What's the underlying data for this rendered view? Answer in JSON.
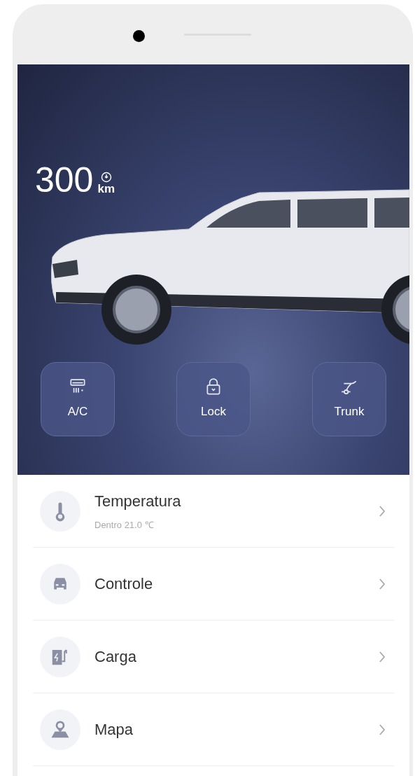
{
  "range": {
    "value": "300",
    "unit": "km"
  },
  "quick_actions": [
    {
      "kind": "ac",
      "label": "A/C"
    },
    {
      "kind": "lock",
      "label": "Lock"
    },
    {
      "kind": "trunk",
      "label": "Trunk"
    }
  ],
  "menu": [
    {
      "kind": "temperature",
      "title": "Temperatura",
      "subtitle": "Dentro 21.0 ℃"
    },
    {
      "kind": "car",
      "title": "Controle"
    },
    {
      "kind": "charge",
      "title": "Carga"
    },
    {
      "kind": "map",
      "title": "Mapa"
    }
  ]
}
